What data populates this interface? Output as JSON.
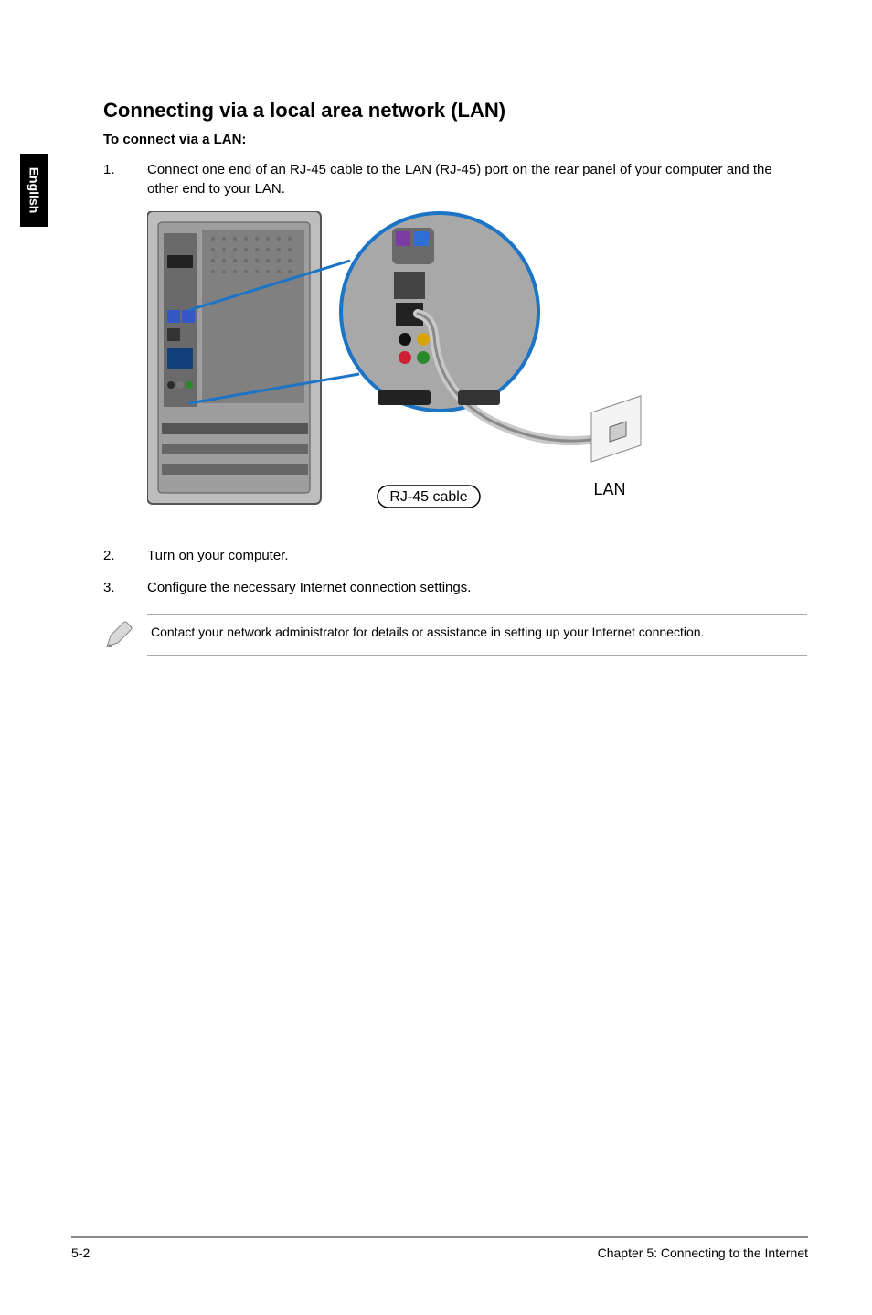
{
  "language_tab": "English",
  "heading": "Connecting via a local area network (LAN)",
  "subheading": "To connect via a LAN:",
  "steps": {
    "1": {
      "num": "1.",
      "text": "Connect one end of an RJ-45 cable to the LAN (RJ-45) port on the rear panel of your computer and the other end to your LAN."
    },
    "2": {
      "num": "2.",
      "text": "Turn on your computer."
    },
    "3": {
      "num": "3.",
      "text": "Configure the necessary Internet connection settings."
    }
  },
  "figure": {
    "rj45_label": "RJ-45 cable",
    "lan_label": "LAN"
  },
  "note": "Contact your network administrator for details or assistance in setting up your Internet connection.",
  "footer": {
    "page": "5-2",
    "chapter": "Chapter 5: Connecting to the Internet"
  }
}
